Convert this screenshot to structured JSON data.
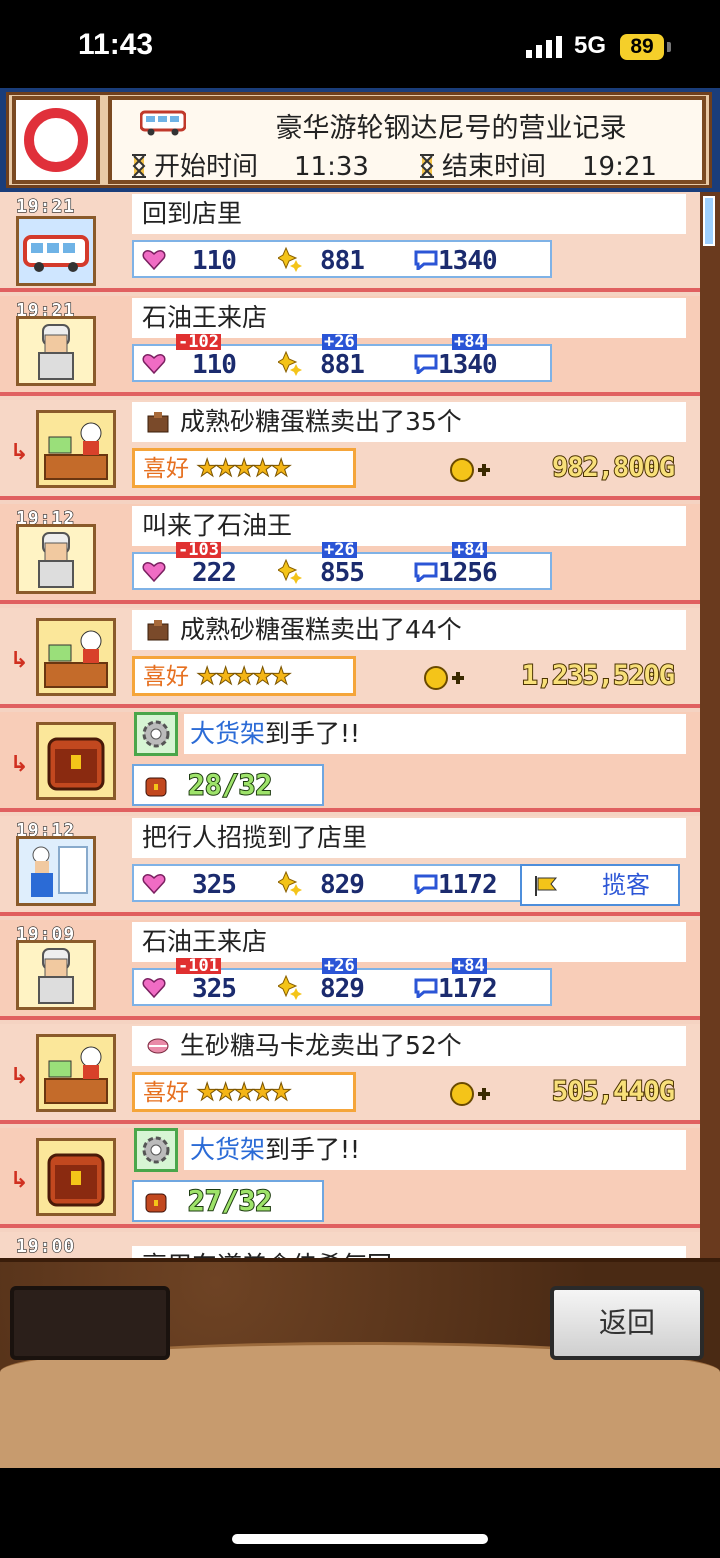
{
  "status": {
    "time": "11:43",
    "network": "5G",
    "battery": "89"
  },
  "header": {
    "title": "豪华游轮钢达尼号的营业记录",
    "start_label": "开始时间",
    "start_time": "11:33",
    "end_label": "结束时间",
    "end_time": "19:21"
  },
  "entries": [
    {
      "time": "19:21",
      "text": "回到店里",
      "hearts": "110",
      "spark": "881",
      "talk": "1340"
    },
    {
      "time": "19:21",
      "text": "石油王来店",
      "hearts": "110",
      "spark": "881",
      "talk": "1340",
      "d_heart": "-102",
      "d_spark": "+26",
      "d_talk": "+84"
    },
    {
      "text": "成熟砂糖蛋糕卖出了35个",
      "pref": "喜好",
      "stars": "★★★★★",
      "gold": "982,800G"
    },
    {
      "time": "19:12",
      "text": "叫来了石油王",
      "hearts": "222",
      "spark": "855",
      "talk": "1256",
      "d_heart": "-103",
      "d_spark": "+26",
      "d_talk": "+84"
    },
    {
      "text": "成熟砂糖蛋糕卖出了44个",
      "pref": "喜好",
      "stars": "★★★★★",
      "gold": "1,235,520G"
    },
    {
      "text_blue": "大货架",
      "text": "到手了!!",
      "count": "28/32"
    },
    {
      "time": "19:12",
      "text": "把行人招揽到了店里",
      "hearts": "325",
      "spark": "829",
      "talk": "1172",
      "button": "揽客"
    },
    {
      "time": "19:09",
      "text": "石油王来店",
      "hearts": "325",
      "spark": "829",
      "talk": "1172",
      "d_heart": "-101",
      "d_spark": "+26",
      "d_talk": "+84"
    },
    {
      "text": "生砂糖马卡龙卖出了52个",
      "pref": "喜好",
      "stars": "★★★★★",
      "gold": "505,440G"
    },
    {
      "text_blue": "大货架",
      "text": "到手了!!",
      "count": "27/32"
    },
    {
      "time": "19:00",
      "text": "享用东道美食佳肴每回"
    }
  ],
  "footer": {
    "back_label": "返回"
  }
}
